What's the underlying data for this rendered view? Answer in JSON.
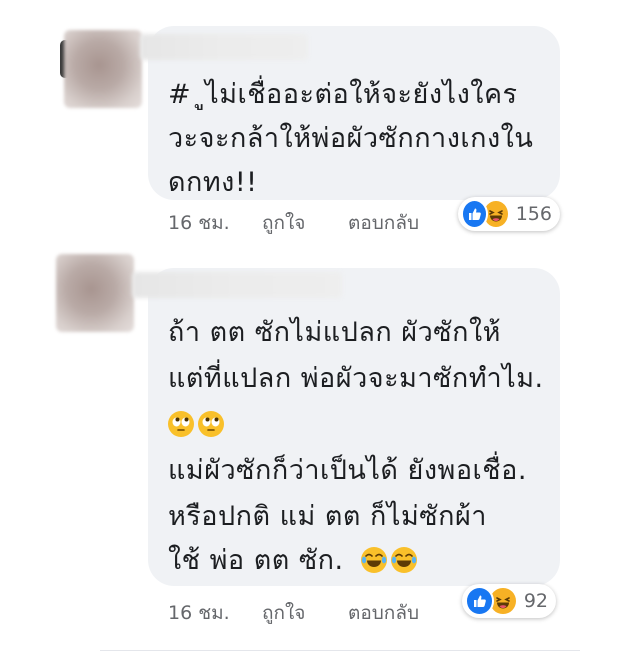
{
  "comments": [
    {
      "lines": [
        "# ูไม่เชื่ออะต่อให้จะยังไงใคร",
        "วะจะกล้าให้พ่อผัวซักกางเกงใน",
        "ดกทง!!"
      ],
      "time": "16 ชม.",
      "like_label": "ถูกใจ",
      "reply_label": "ตอบกลับ",
      "reaction_count": "156",
      "reactions": [
        "like-icon",
        "haha-icon"
      ]
    },
    {
      "lines": [
        "ถ้า ตต ซักไม่แปลก ผัวซักให้",
        "แต่ที่แปลก พ่อผัวจะมาซักทำไม.",
        "",
        "แม่ผัวซักก็ว่าเป็นได้ ยังพอเชื่อ.",
        "หรือปกติ แม่ ตต ก็ไม่ซักผ้า",
        "ใช้ พ่อ ตต ซัก."
      ],
      "emoji_line_icons": [
        "eye-roll-emoji-icon",
        "eye-roll-emoji-icon"
      ],
      "trailing_emoji_icons": [
        "tears-of-joy-emoji-icon",
        "tears-of-joy-emoji-icon"
      ],
      "time": "16 ชม.",
      "like_label": "ถูกใจ",
      "reply_label": "ตอบกลับ",
      "reaction_count": "92",
      "reactions": [
        "like-icon",
        "haha-icon"
      ]
    }
  ],
  "colors": {
    "bubble": "#f0f2f5",
    "text": "#1c1e21",
    "meta": "#65676b",
    "like": "#1877f2",
    "haha": "#f7b125"
  }
}
